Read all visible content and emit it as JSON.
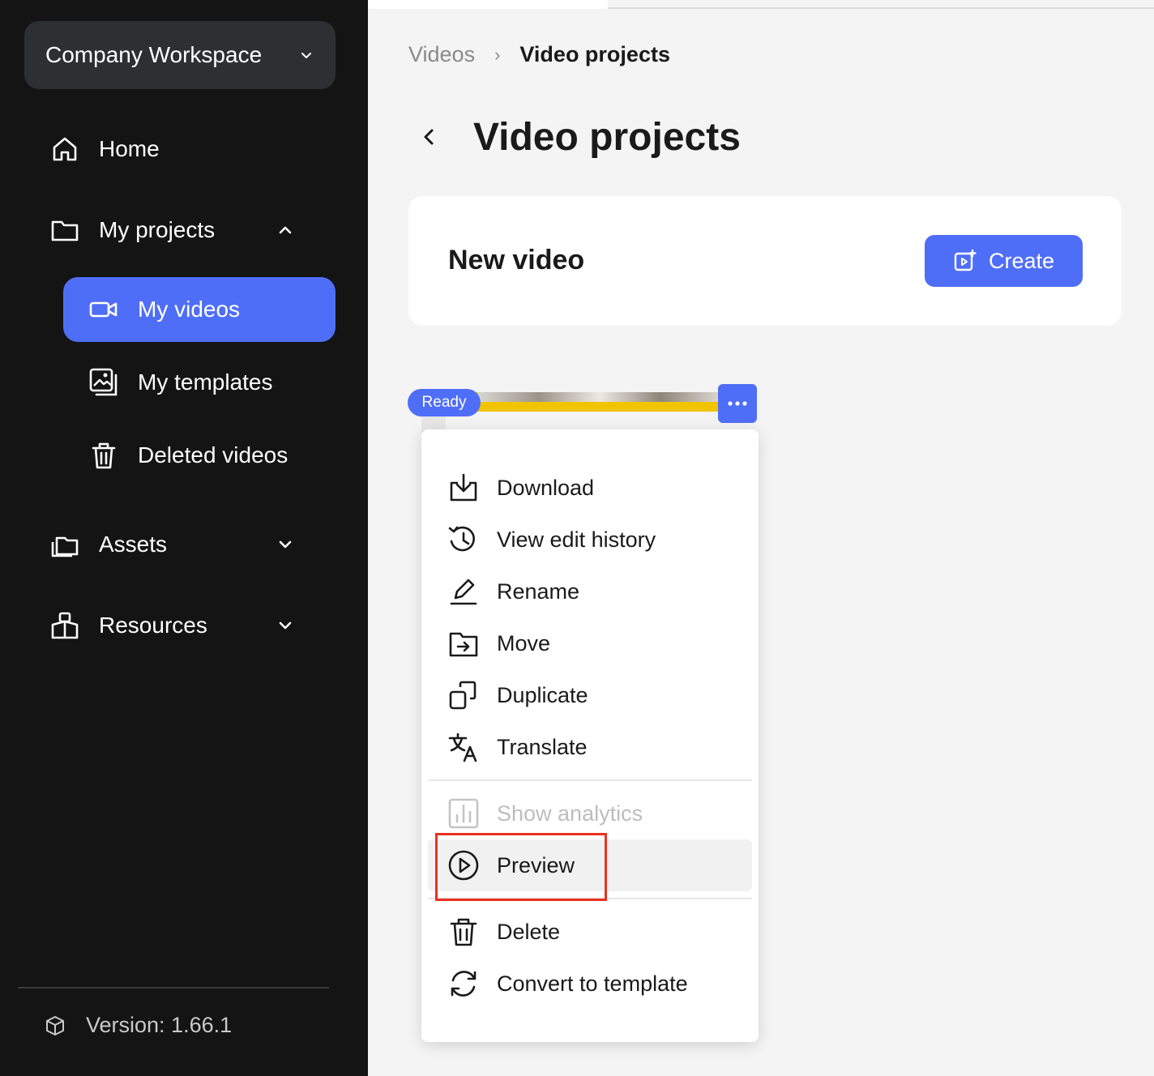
{
  "sidebar": {
    "workspace": "Company Workspace",
    "items": {
      "home": "Home",
      "my_projects": "My projects",
      "my_videos": "My videos",
      "my_templates": "My templates",
      "deleted_videos": "Deleted videos",
      "assets": "Assets",
      "resources": "Resources"
    },
    "version": "Version: 1.66.1"
  },
  "breadcrumb": {
    "root": "Videos",
    "separator": "›",
    "current": "Video projects"
  },
  "page_title": "Video projects",
  "new_video": {
    "title": "New video",
    "create_label": "Create"
  },
  "video": {
    "status": "Ready"
  },
  "menu": {
    "download": "Download",
    "view_edit_history": "View edit history",
    "rename": "Rename",
    "move": "Move",
    "duplicate": "Duplicate",
    "translate": "Translate",
    "show_analytics": "Show analytics",
    "preview": "Preview",
    "delete": "Delete",
    "convert_to_template": "Convert to template"
  },
  "colors": {
    "accent": "#4f6ef7",
    "sidebar_bg": "#141414",
    "highlight": "#e8321e",
    "thumb_bar": "#f2c400"
  }
}
